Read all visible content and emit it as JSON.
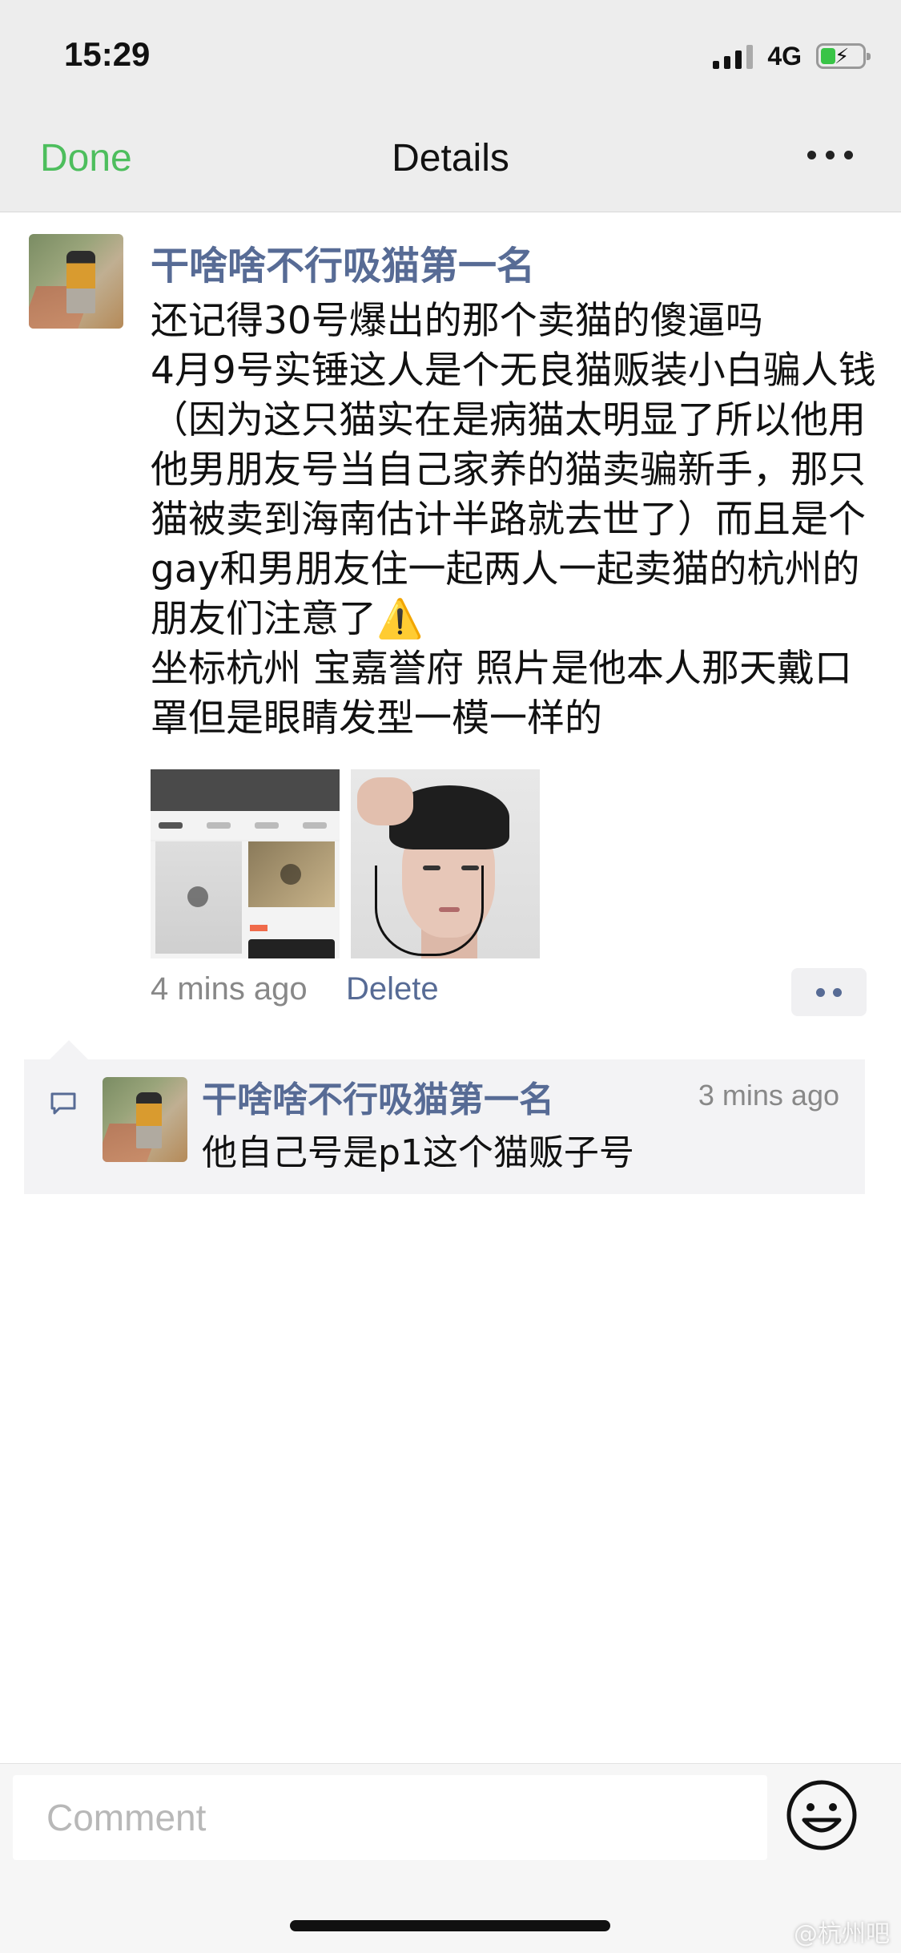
{
  "status_bar": {
    "time": "15:29",
    "network": "4G"
  },
  "nav": {
    "done_label": "Done",
    "title": "Details"
  },
  "post": {
    "author": "干啥啥不行吸猫第一名",
    "text": "还记得30号爆出的那个卖猫的傻逼吗\n4月9号实锤这人是个无良猫贩装小白骗人钱（因为这只猫实在是病猫太明显了所以他用他男朋友号当自己家养的猫卖骗新手，那只猫被卖到海南估计半路就去世了）而且是个gay和男朋友住一起两人一起卖猫的杭州的朋友们注意了",
    "warning_emoji": "⚠️",
    "text_after": "坐标杭州 宝嘉誉府 照片是他本人那天戴口罩但是眼睛发型一模一样的",
    "time": "4 mins ago",
    "delete_label": "Delete"
  },
  "comments": [
    {
      "author": "干啥啥不行吸猫第一名",
      "time": "3 mins ago",
      "text": "他自己号是p1这个猫贩子号"
    }
  ],
  "composer": {
    "placeholder": "Comment"
  },
  "icons": {
    "more": "more-horizontal-icon",
    "comment": "comment-bubble-icon",
    "emoji": "smiley-icon",
    "battery": "battery-charging-icon",
    "signal": "cellular-signal-icon"
  },
  "colors": {
    "accent_green": "#4dbe5d",
    "link_blue": "#576b95"
  },
  "watermark": "@杭州吧"
}
